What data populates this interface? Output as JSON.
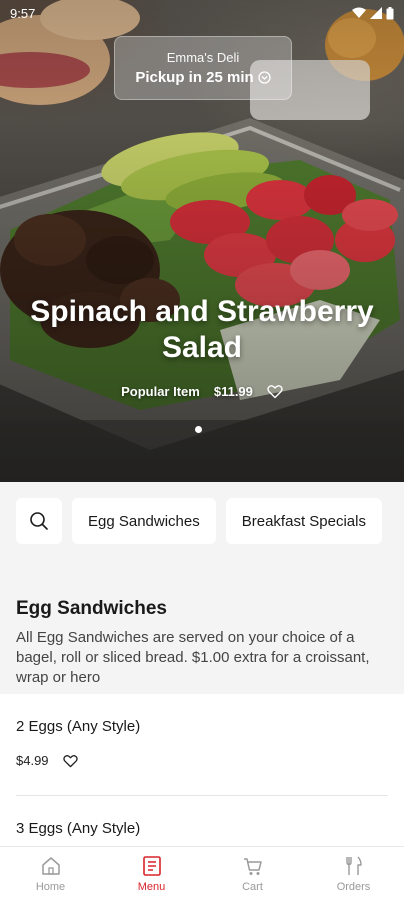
{
  "status_bar": {
    "time": "9:57"
  },
  "store": {
    "name": "Emma's Deli",
    "pickup": "Pickup in 25 min"
  },
  "featured": {
    "title": "Spinach and Strawberry Salad",
    "tag": "Popular Item",
    "price": "$11.99"
  },
  "categories": [
    "Egg Sandwiches",
    "Breakfast Specials"
  ],
  "section": {
    "title": "Egg Sandwiches",
    "description": "All Egg Sandwiches are served on your choice of a bagel, roll or sliced bread. $1.00 extra for a croissant, wrap or hero"
  },
  "items": [
    {
      "name": "2 Eggs (Any Style)",
      "price": "$4.99"
    },
    {
      "name": "3 Eggs (Any Style)",
      "price": ""
    }
  ],
  "nav": {
    "items": [
      {
        "label": "Home",
        "icon": "home-icon"
      },
      {
        "label": "Menu",
        "icon": "menu-icon"
      },
      {
        "label": "Cart",
        "icon": "cart-icon"
      },
      {
        "label": "Orders",
        "icon": "orders-icon"
      }
    ],
    "active": "Menu",
    "active_color": "#d8232a",
    "inactive_color": "#9a9a9a"
  }
}
